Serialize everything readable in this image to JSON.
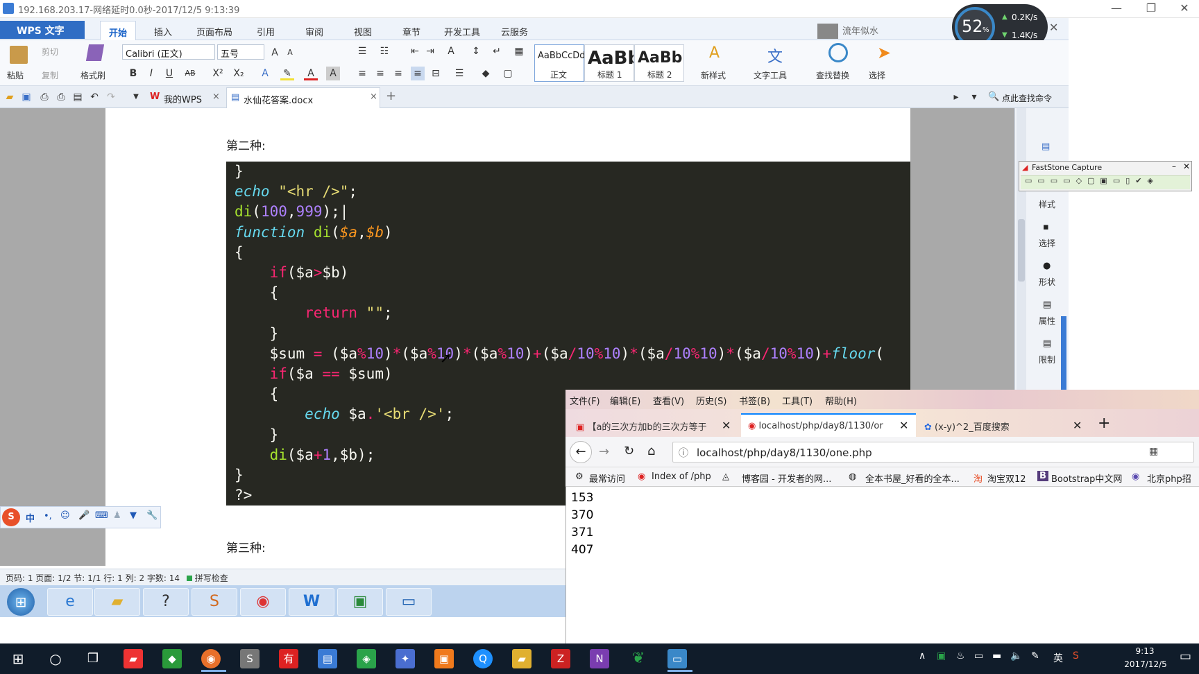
{
  "window": {
    "title": "192.168.203.17-网络延时0.0秒-2017/12/5 9:13:39",
    "min_btn": "—",
    "max_btn": "❐",
    "close_btn": "✕"
  },
  "wps": {
    "app_button": "WPS 文字",
    "tabs": [
      "开始",
      "插入",
      "页面布局",
      "引用",
      "审阅",
      "视图",
      "章节",
      "开发工具",
      "云服务"
    ],
    "user_label": "流年似水",
    "clipboard": {
      "paste": "粘贴",
      "cut": "剪切",
      "copy": "复制",
      "format_painter": "格式刷"
    },
    "font_name": "Calibri (正文)",
    "font_size": "五号",
    "styles": [
      {
        "preview": "AaBbCcDd",
        "label": "正文"
      },
      {
        "preview": "AaBb",
        "label": "标题 1"
      },
      {
        "preview": "AaBb(",
        "label": "标题 2"
      }
    ],
    "new_style": "新样式",
    "text_tools": "文字工具",
    "find_replace": "查找替换",
    "select": "选择",
    "doc_tabs": [
      "我的WPS",
      "水仙花答案.docx"
    ],
    "command_search": "点此查找命令",
    "heading_2": "第二种:",
    "heading_3": "第三种:",
    "right_panel": [
      "样式",
      "选择",
      "形状",
      "属性",
      "限制"
    ],
    "status": "页码: 1   页面: 1/2   节: 1/1   行: 1   列: 2   字数: 14",
    "spell_check": "拼写检查"
  },
  "code_lines": [
    "}",
    "echo \"<hr />\";",
    "di(100,999);",
    "function di($a,$b)",
    "{",
    "    if($a>$b)",
    "    {",
    "        return \"\";",
    "    }",
    "    $sum = ($a%10)*($a%10)*($a%10)+($a/10%10)*($a/10%10)*($a/10%10)+floor(",
    "    if($a == $sum)",
    "    {",
    "        echo $a.'<br />';",
    "    }",
    "    di($a+1,$b);",
    "}",
    "?>"
  ],
  "network_widget": {
    "percent": "52",
    "unit": "%",
    "up": "0.2K/s",
    "down": "1.4K/s"
  },
  "faststone": {
    "title": "FastStone Capture"
  },
  "ime": {
    "lang": "中"
  },
  "firefox": {
    "menu": [
      "文件(F)",
      "编辑(E)",
      "查看(V)",
      "历史(S)",
      "书签(B)",
      "工具(T)",
      "帮助(H)"
    ],
    "tabs": [
      "【a的三次方加b的三次方等于",
      "localhost/php/day8/1130/or",
      "(x-y)^2_百度搜索"
    ],
    "url": "localhost/php/day8/1130/one.php",
    "bookmarks": [
      "最常访问",
      "Index of /php",
      "博客园 - 开发者的网...",
      "全本书屋_好看的全本...",
      "淘宝双12",
      "Bootstrap中文网",
      "北京php招"
    ],
    "output": [
      "153",
      "370",
      "371",
      "407"
    ]
  },
  "win10": {
    "time": "9:13",
    "date": "2017/12/5",
    "lang": "英"
  }
}
